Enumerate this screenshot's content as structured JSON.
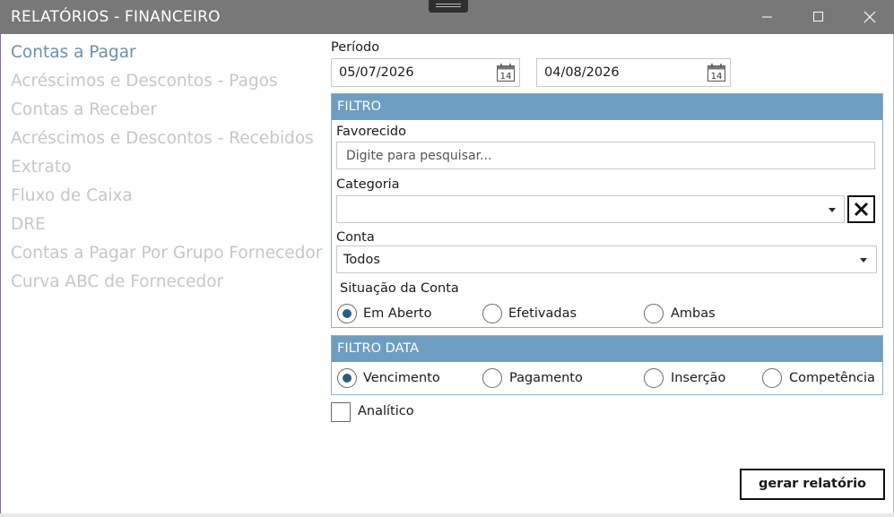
{
  "window": {
    "title": "RELATÓRIOS - FINANCEIRO",
    "controls": [
      "minimize-icon",
      "maximize-icon",
      "close-icon"
    ]
  },
  "nav": {
    "items": [
      {
        "label": "Contas a Pagar",
        "active": true
      },
      {
        "label": "Acréscimos e Descontos - Pagos",
        "active": false
      },
      {
        "label": "Contas a Receber",
        "active": false
      },
      {
        "label": "Acréscimos e Descontos - Recebidos",
        "active": false
      },
      {
        "label": "Extrato",
        "active": false
      },
      {
        "label": "Fluxo de Caixa",
        "active": false
      },
      {
        "label": "DRE",
        "active": false
      },
      {
        "label": "Contas a Pagar Por Grupo Fornecedor",
        "active": false
      },
      {
        "label": "Curva ABC de Fornecedor",
        "active": false
      }
    ]
  },
  "periodo": {
    "label": "Período",
    "start": "05/07/2026",
    "end": "04/08/2026",
    "calendar_day": "14"
  },
  "filtro": {
    "header": "FILTRO",
    "favorecido_label": "Favorecido",
    "favorecido_placeholder": "Digite para pesquisar...",
    "categoria_label": "Categoria",
    "categoria_value": "",
    "conta_label": "Conta",
    "conta_value": "Todos",
    "situacao_label": "Situação da Conta",
    "situacao_options": [
      {
        "label": "Em Aberto",
        "checked": true
      },
      {
        "label": "Efetivadas",
        "checked": false
      },
      {
        "label": "Ambas",
        "checked": false
      }
    ]
  },
  "filtro_data": {
    "header": "FILTRO DATA",
    "options": [
      {
        "label": "Vencimento",
        "checked": true
      },
      {
        "label": "Pagamento",
        "checked": false
      },
      {
        "label": "Inserção",
        "checked": false
      },
      {
        "label": "Competência",
        "checked": false
      }
    ]
  },
  "analitico": {
    "label": "Analítico",
    "checked": false
  },
  "actions": {
    "generate_label": "gerar relatório"
  },
  "colors": {
    "titlebar": "#787878",
    "group_header": "#6e9dc2",
    "nav_active": "#6d8fab",
    "nav_inactive": "#c6c6c6",
    "radio_fill": "#2f5b80"
  }
}
